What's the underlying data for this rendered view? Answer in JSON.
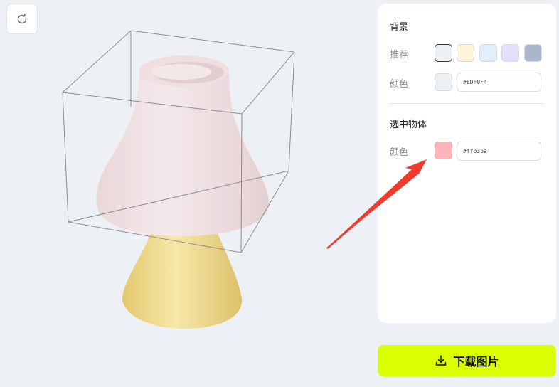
{
  "background": {
    "section_title": "背景",
    "recommend_label": "推荐",
    "swatches": [
      "#EDF0F4",
      "#FFF3D9",
      "#E1EEFB",
      "#E4E0FA",
      "#A9B6CC"
    ],
    "color_label": "颜色",
    "color_value": "#EDF0F4"
  },
  "selected_object": {
    "section_title": "选中物体",
    "color_label": "颜色",
    "color_value": "#ffb3ba"
  },
  "download": {
    "label": "下载图片"
  },
  "model": {
    "shade_color": "#f2e3e5",
    "base_color": "#f0dc8a"
  },
  "annotation": {
    "arrow_color": "#f23a2e"
  },
  "icons": [
    "refresh-icon",
    "download-icon"
  ]
}
